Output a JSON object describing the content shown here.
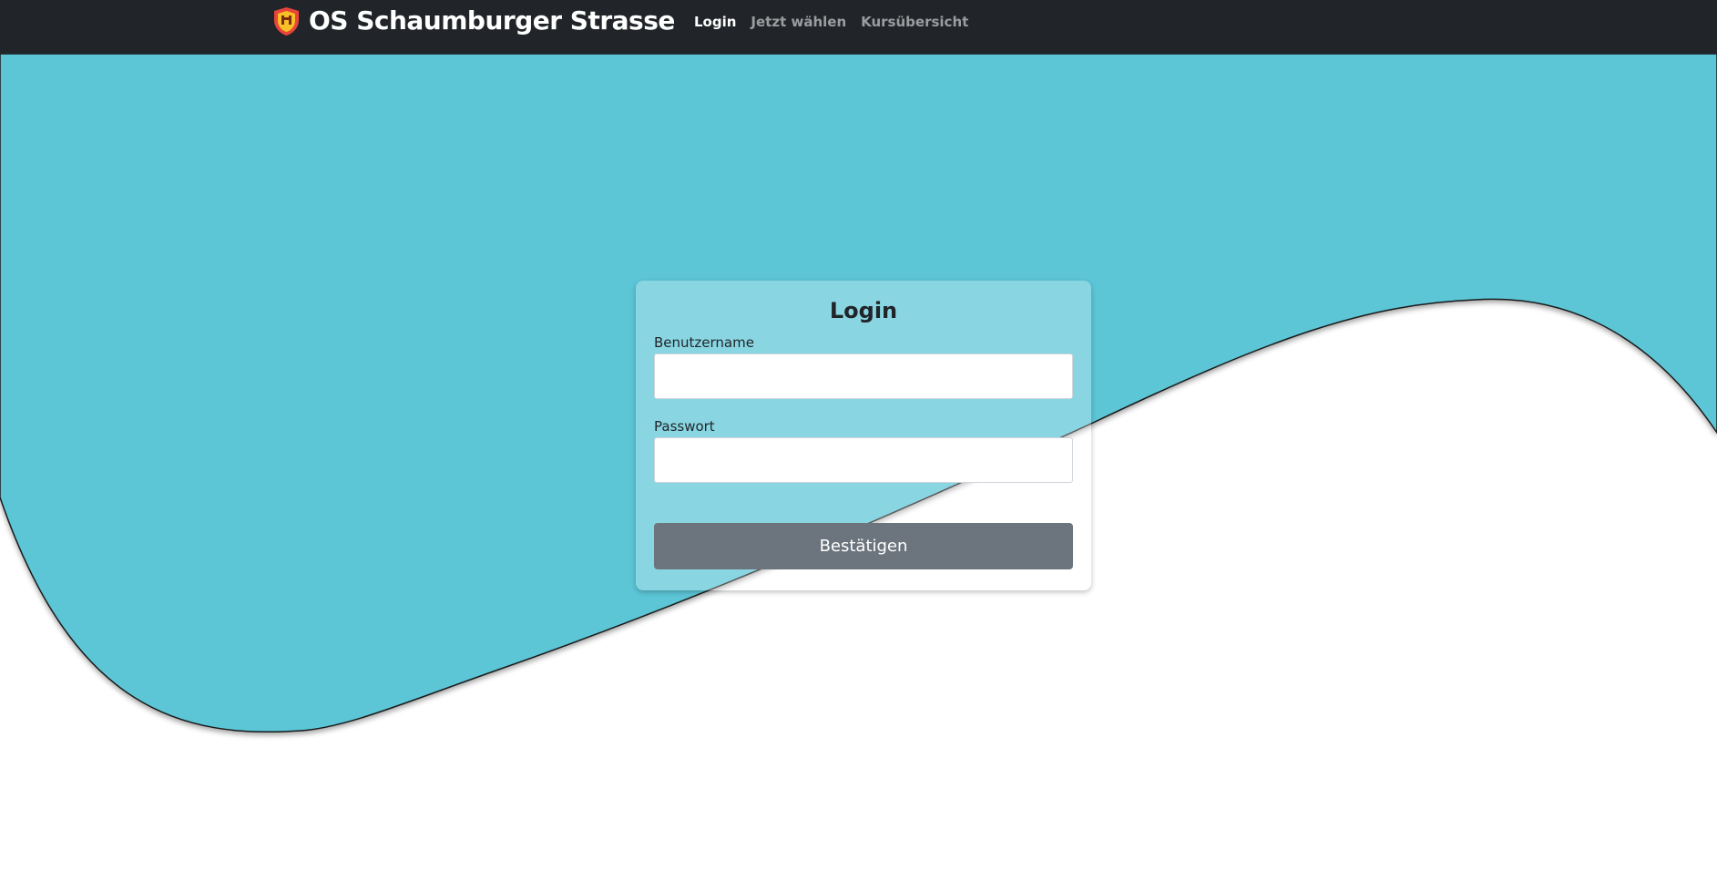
{
  "navbar": {
    "brand_title": "OS Schaumburger Strasse",
    "logo_icon": "shield-crest-icon",
    "links": [
      {
        "label": "Login",
        "active": true
      },
      {
        "label": "Jetzt wählen",
        "active": false
      },
      {
        "label": "Kursübersicht",
        "active": false
      }
    ]
  },
  "login": {
    "title": "Login",
    "username_label": "Benutzername",
    "username_value": "",
    "password_label": "Passwort",
    "password_value": "",
    "submit_label": "Bestätigen"
  },
  "colors": {
    "navbar": "#212529",
    "wave": "#5bc6d7",
    "button": "#6c757d",
    "page": "#ffffff"
  }
}
